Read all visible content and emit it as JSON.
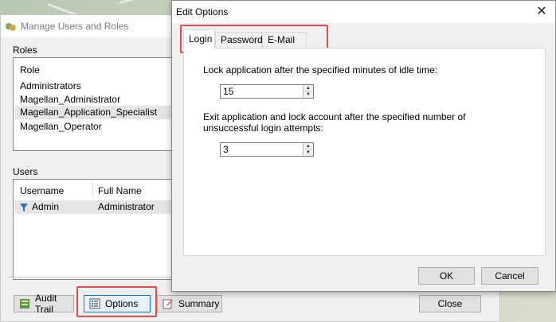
{
  "manage_window": {
    "title": "Manage Users and Roles",
    "roles_label": "Roles",
    "roles_header": "Role",
    "roles": [
      "Administrators",
      "Magellan_Administrator",
      "Magellan_Application_Specialist",
      "Magellan_Operator"
    ],
    "selected_role_index": 2,
    "users_label": "Users",
    "users_columns": [
      "Username",
      "Full Name"
    ],
    "users": [
      {
        "username": "Admin",
        "full_name": "Administrator"
      }
    ],
    "buttons": {
      "audit_trail": "Audit Trail",
      "options": "Options",
      "summary": "Summary",
      "close": "Close"
    }
  },
  "dialog": {
    "title": "Edit Options",
    "close_glyph": "✕",
    "tabs": [
      "Login",
      "Password",
      "E-Mail"
    ],
    "active_tab": "Login",
    "idle_prompt": "Lock application after the specified minutes of idle time:",
    "idle_value": "15",
    "attempts_prompt": "Exit application and lock account after the specified number of unsuccessful login attempts:",
    "attempts_value": "3",
    "ok_label": "OK",
    "cancel_label": "Cancel"
  },
  "colors": {
    "highlight_box": "#e8484f",
    "focus_border": "#0078d7"
  },
  "icons": {
    "window": "users-icon",
    "audit": "audit-trail-icon",
    "options": "options-icon",
    "summary": "summary-icon",
    "user_row": "user-filter-icon"
  }
}
